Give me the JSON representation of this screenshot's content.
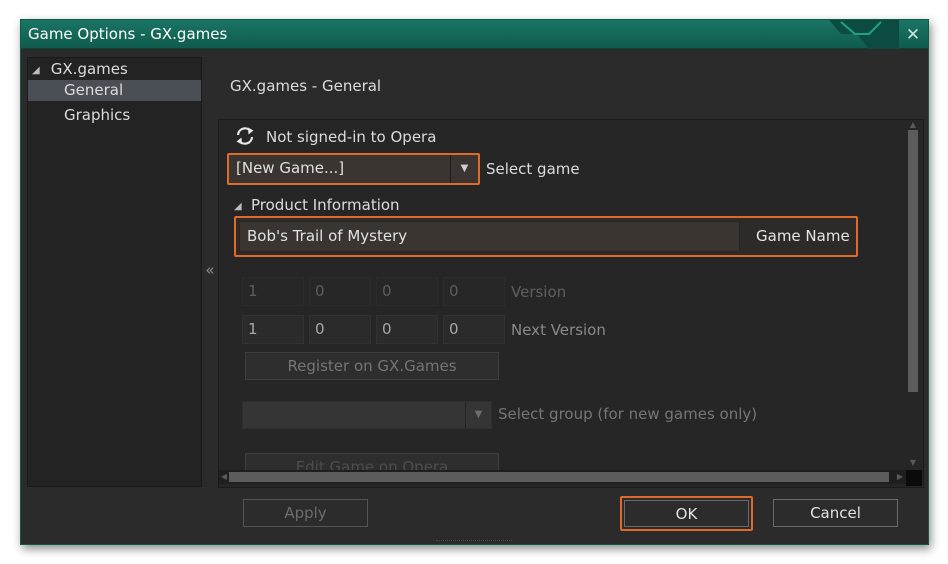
{
  "window": {
    "title": "Game Options - GX.games",
    "close_label": "✕"
  },
  "tree": {
    "root_label": "GX.games",
    "items": [
      {
        "label": "General",
        "selected": true
      },
      {
        "label": "Graphics",
        "selected": false
      }
    ],
    "collapse_label": "«"
  },
  "section_title": "GX.games - General",
  "signin": {
    "status": "Not signed-in to Opera",
    "icon": "refresh-icon"
  },
  "game_select": {
    "value": "[New Game...]",
    "label": "Select game"
  },
  "product_info": {
    "header": "Product Information",
    "game_name_value": "Bob's Trail of Mystery",
    "game_name_label": "Game Name"
  },
  "version": {
    "values": [
      "1",
      "0",
      "0",
      "0"
    ],
    "label": "Version"
  },
  "next_version": {
    "values": [
      "1",
      "0",
      "0",
      "0"
    ],
    "label": "Next Version"
  },
  "register_button": "Register on GX.Games",
  "group_select": {
    "value": "",
    "label": "Select group (for new games only)"
  },
  "edit_game_button": "Edit Game on Opera",
  "buttons": {
    "apply": "Apply",
    "ok": "OK",
    "cancel": "Cancel"
  },
  "colors": {
    "highlight": "#e06a2c",
    "titlebar": "#136b5a"
  }
}
